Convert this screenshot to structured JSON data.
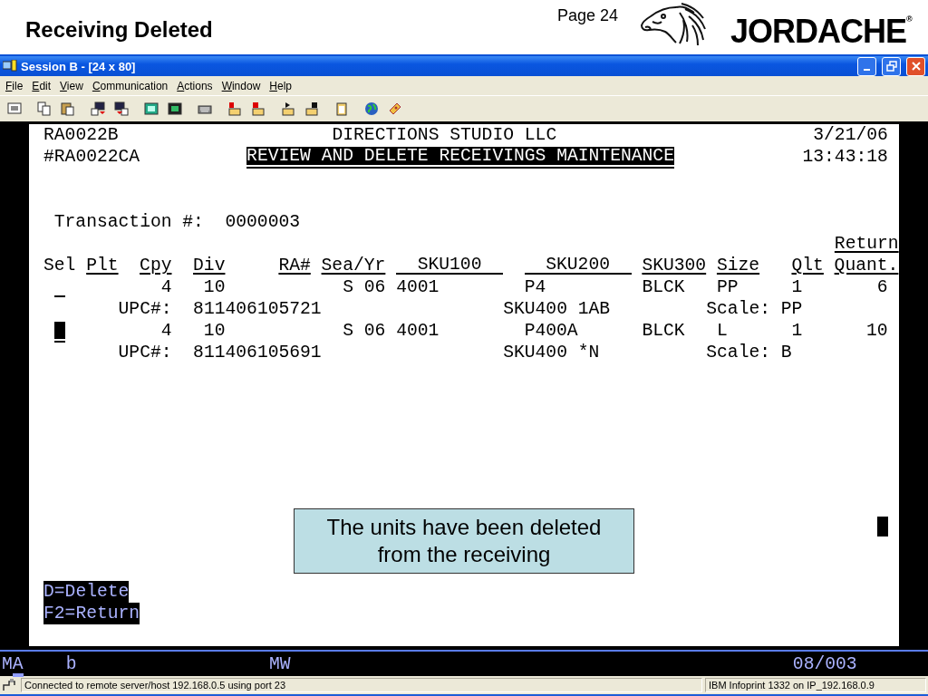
{
  "slide": {
    "title": "Receiving Deleted",
    "page": "Page 24",
    "brand": "JORDACHE",
    "brand_mark": "®"
  },
  "window": {
    "title": "Session B - [24 x 80]"
  },
  "menu": [
    "File",
    "Edit",
    "View",
    "Communication",
    "Actions",
    "Window",
    "Help"
  ],
  "terminal": {
    "program": "RA0022B",
    "company": "DIRECTIONS STUDIO LLC",
    "date": "3/21/06",
    "format": "#RA0022CA",
    "screen_title": "REVIEW AND DELETE RECEIVINGS MAINTENANCE",
    "time": "13:43:18",
    "transaction_label": "Transaction #:",
    "transaction_number": "0000003",
    "columns": [
      {
        "label": "Sel"
      },
      {
        "label": "Plt"
      },
      {
        "label": "Cpy"
      },
      {
        "label": "Div"
      },
      {
        "label": "RA#"
      },
      {
        "label": "Sea/Yr"
      },
      {
        "label": "SKU100"
      },
      {
        "label": "SKU200"
      },
      {
        "label": "SKU300"
      },
      {
        "label": "Size"
      },
      {
        "label": "Qlt"
      },
      {
        "label": "Quant.",
        "label_top": "Return"
      }
    ],
    "rows": [
      {
        "cursor": false,
        "cpy": "4",
        "div": "10",
        "season": "S 06",
        "sku100": "4001",
        "sku200": "P4",
        "sku300": "BLCK",
        "size": "PP",
        "qlt": "1",
        "quantity": "6",
        "upc_label": "UPC#:",
        "upc": "811406105721",
        "sku400": "SKU400 1AB",
        "scale_label": "Scale:",
        "scale": "PP"
      },
      {
        "cursor": true,
        "cpy": "4",
        "div": "10",
        "season": "S 06",
        "sku100": "4001",
        "sku200": "P400A",
        "sku300": "BLCK",
        "size": "L",
        "qlt": "1",
        "quantity": "10",
        "upc_label": "UPC#:",
        "upc": "811406105691",
        "sku400": "SKU400 *N",
        "scale_label": "Scale:",
        "scale": "B"
      }
    ],
    "block_cursor": true,
    "function_keys": [
      "D=Delete",
      "F2=Return"
    ],
    "status_line": {
      "indicator": "MA",
      "cursor": true,
      "field_2": "b",
      "field_3": "MW",
      "position": "08/003"
    }
  },
  "callout": {
    "text": "The units have been deleted from the receiving"
  },
  "status_bar": {
    "message": "Connected to remote server/host 192.168.0.5 using port 23",
    "printer": "IBM Infoprint 1332 on IP_192.168.0.9"
  }
}
